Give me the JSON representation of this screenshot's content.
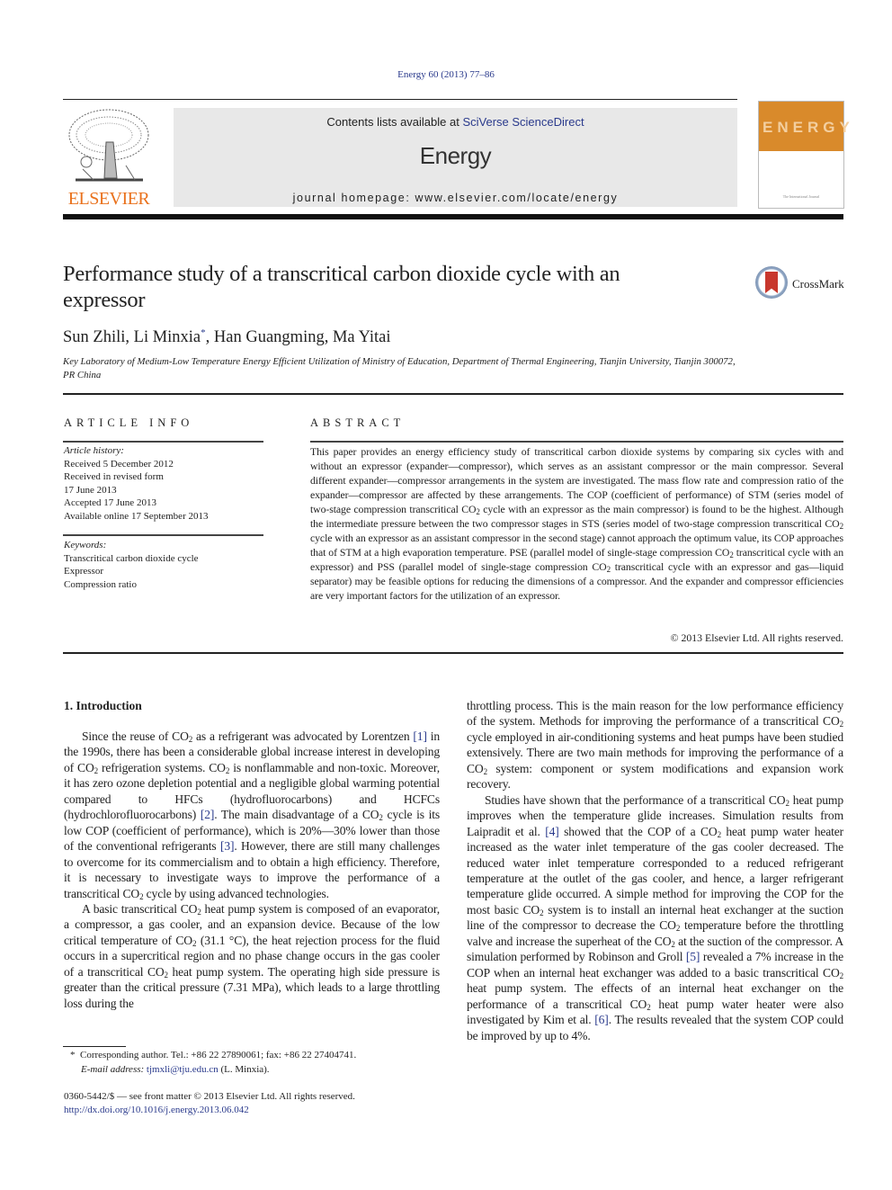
{
  "header": {
    "journal_ref": "Energy 60 (2013) 77–86",
    "contents_prefix": "Contents lists available at ",
    "contents_link": "SciVerse ScienceDirect",
    "journal_name": "Energy",
    "homepage_prefix": "journal homepage: ",
    "homepage_url": "www.elsevier.com/locate/energy",
    "publisher_logo_text": "ELSEVIER",
    "cover_title": "ENERGY",
    "cover_subtitle": "The International Journal",
    "colors": {
      "elsevier_orange": "#e9711c",
      "cover_orange": "#d98a2b",
      "link_blue": "#2a3a8c",
      "header_gray": "#e8e8e8"
    }
  },
  "article": {
    "title": "Performance study of a transcritical carbon dioxide cycle with an expressor",
    "crossmark_label": "CrossMark",
    "authors": [
      {
        "name": "Sun Zhili",
        "mark": ""
      },
      {
        "name": "Li Minxia",
        "mark": "*"
      },
      {
        "name": "Han Guangming",
        "mark": ""
      },
      {
        "name": "Ma Yitai",
        "mark": ""
      }
    ],
    "affiliation": "Key Laboratory of Medium-Low Temperature Energy Efficient Utilization of Ministry of Education, Department of Thermal Engineering, Tianjin University, Tianjin 300072, PR China"
  },
  "article_info": {
    "heading": "ARTICLE INFO",
    "history_label": "Article history:",
    "history": [
      "Received 5 December 2012",
      "Received in revised form",
      "17 June 2013",
      "Accepted 17 June 2013",
      "Available online 17 September 2013"
    ],
    "keywords_label": "Keywords:",
    "keywords": [
      "Transcritical carbon dioxide cycle",
      "Expressor",
      "Compression ratio"
    ]
  },
  "abstract": {
    "heading": "ABSTRACT",
    "copyright": "© 2013 Elsevier Ltd. All rights reserved."
  },
  "introduction": {
    "heading": "1.  Introduction"
  },
  "footnote": {
    "corresponding": "Corresponding author. Tel.: +86 22 27890061; fax: +86 22 27404741.",
    "email_label": "E-mail address:",
    "email": "tjmxli@tju.edu.cn",
    "email_suffix": "(L. Minxia).",
    "issn": "0360-5442/$ — see front matter © 2013 Elsevier Ltd. All rights reserved.",
    "doi": "http://dx.doi.org/10.1016/j.energy.2013.06.042"
  },
  "text": {
    "ab1": "This paper provides an energy efficiency study of transcritical carbon dioxide systems by comparing six cycles with and without an expressor (expander—compressor), which serves as an assistant compressor or the main compressor. Several different expander—compressor arrangements in the system are investigated. The mass flow rate and compression ratio of the expander—compressor are affected by these arrangements. The COP (coefficient of performance) of STM (series model of two-stage compression transcritical CO",
    "ab2": " cycle with an expressor as the main compressor) is found to be the highest. Although the intermediate pressure between the two compressor stages in STS (series model of two-stage compression transcritical CO",
    "ab3": " cycle with an expressor as an assistant compressor in the second stage) cannot approach the optimum value, its COP approaches that of STM at a high evaporation temperature. PSE (parallel model of single-stage compression CO",
    "ab4": " transcritical cycle with an expressor) and PSS (parallel model of single-stage compression CO",
    "ab5": " transcritical cycle with an expressor and gas—liquid separator) may be feasible options for reducing the dimensions of a compressor. And the expander and compressor efficiencies are very important factors for the utilization of an expressor.",
    "sub2": "2",
    "co": "CO",
    "p1a": "Since the reuse of ",
    "p1b": " as a refrigerant was advocated by Lorentzen ",
    "ref1": "[1]",
    "p1c": " in the 1990s, there has been a considerable global increase interest in developing of ",
    "p1d": " refrigeration systems. ",
    "p1e": " is nonflammable and non-toxic. Moreover, it has zero ozone depletion potential and a negligible global warming potential compared to HFCs (hydrofluorocarbons) and HCFCs (hydrochlorofluorocarbons) ",
    "ref2": "[2]",
    "p1f": ". The main disadvantage of a ",
    "p1g": " cycle is its low COP (coefficient of performance), which is 20%—30% lower than those of the conventional refrigerants ",
    "ref3": "[3]",
    "p1h": ". However, there are still many challenges to overcome for its commercialism and to obtain a high efficiency. Therefore, it is necessary to investigate ways to improve the performance of a transcritical ",
    "p1i": " cycle by using advanced technologies.",
    "p2a": "A basic transcritical ",
    "p2b": " heat pump system is composed of an evaporator, a compressor, a gas cooler, and an expansion device. Because of the low critical temperature of ",
    "p2c": " (31.1 °C), the heat rejection process for the fluid occurs in a supercritical region and no phase change occurs in the gas cooler of a transcritical ",
    "p2d": " heat pump system. The operating high side pressure is greater than the critical pressure (7.31 MPa), which leads to a large throttling loss during the",
    "r1a": "throttling process. This is the main reason for the low performance efficiency of the system. Methods for improving the performance of a transcritical ",
    "r1b": " cycle employed in air-conditioning systems and heat pumps have been studied extensively. There are two main methods for improving the performance of a ",
    "r1c": " system: component or system modifications and expansion work recovery.",
    "r2a": "Studies have shown that the performance of a transcritical ",
    "r2b": " heat pump improves when the temperature glide increases. Simulation results from Laipradit et al. ",
    "ref4": "[4]",
    "r2c": " showed that the COP of a ",
    "r2d": " heat pump water heater increased as the water inlet temperature of the gas cooler decreased. The reduced water inlet temperature corresponded to a reduced refrigerant temperature at the outlet of the gas cooler, and hence, a larger refrigerant temperature glide occurred. A simple method for improving the COP for the most basic ",
    "r2e": " system is to install an internal heat exchanger at the suction line of the compressor to decrease the ",
    "r2f": " temperature before the throttling valve and increase the superheat of the ",
    "r2g": " at the suction of the compressor. A simulation performed by Robinson and Groll ",
    "ref5": "[5]",
    "r2h": " revealed a 7% increase in the COP when an internal heat exchanger was added to a basic transcritical ",
    "r2i": " heat pump system. The effects of an internal heat exchanger on the performance of a transcritical ",
    "r2j": " heat pump water heater were also investigated by Kim et al. ",
    "ref6": "[6]",
    "r2k": ". The results revealed that the system COP could be improved by up to 4%."
  }
}
